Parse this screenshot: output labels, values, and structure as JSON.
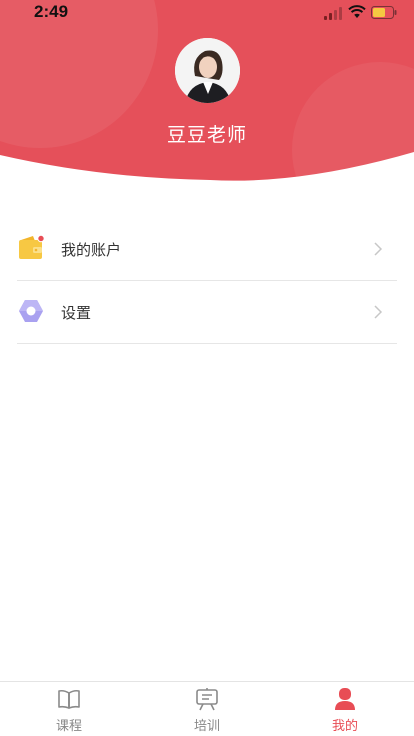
{
  "status_bar": {
    "time": "2:49"
  },
  "profile": {
    "name": "豆豆老师"
  },
  "menu": {
    "items": [
      {
        "label": "我的账户",
        "icon": "wallet-icon",
        "has_badge": true
      },
      {
        "label": "设置",
        "icon": "settings-hexagon-icon",
        "has_badge": false
      }
    ]
  },
  "tabbar": {
    "tabs": [
      {
        "label": "课程",
        "icon": "book-icon",
        "active": false
      },
      {
        "label": "培训",
        "icon": "training-board-icon",
        "active": false
      },
      {
        "label": "我的",
        "icon": "user-icon",
        "active": true
      }
    ]
  },
  "colors": {
    "accent": "#e84d55",
    "header": "#e5505a",
    "wallet": "#f7c843",
    "settings": "#a9a1f0",
    "badge": "#e84d55"
  }
}
